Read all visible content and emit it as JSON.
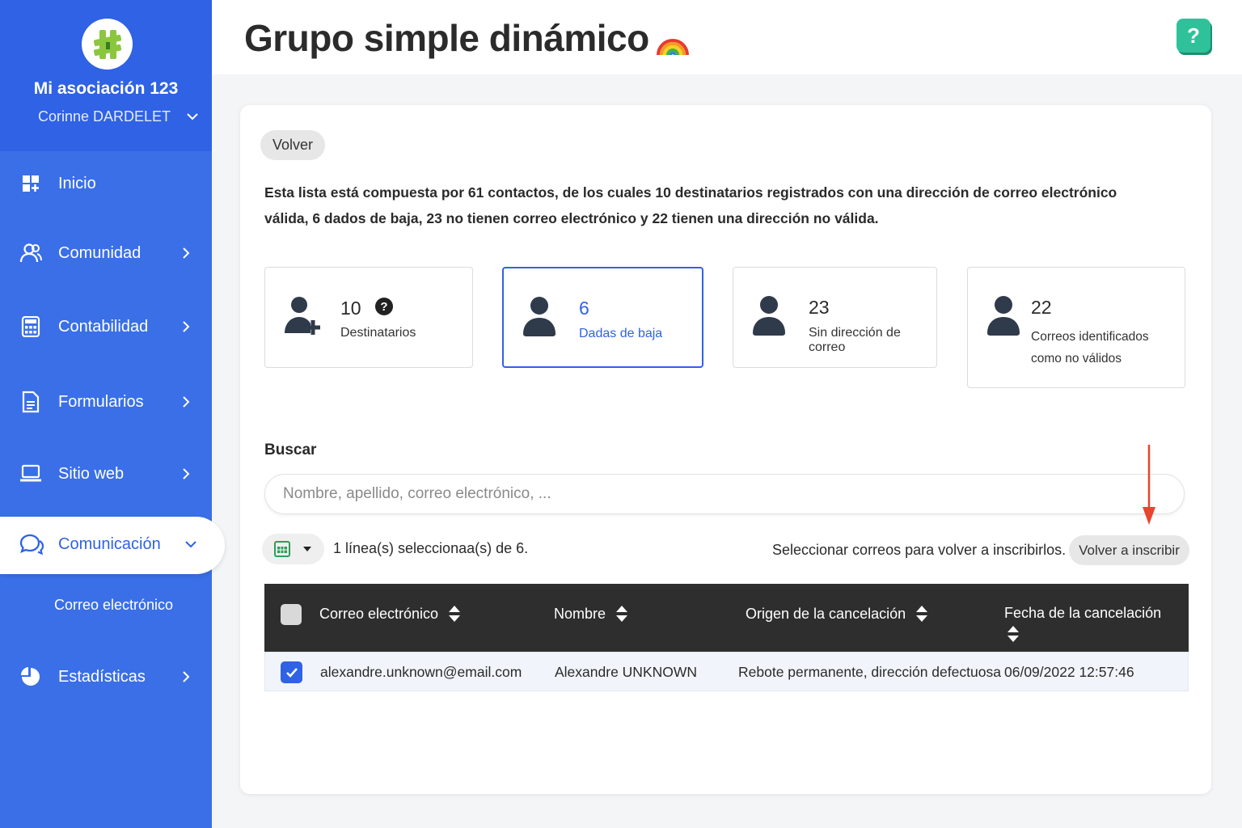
{
  "sidebar": {
    "org_name": "Mi asociación 123",
    "user_name": "Corinne DARDELET",
    "items": [
      {
        "label": "Inicio"
      },
      {
        "label": "Comunidad"
      },
      {
        "label": "Contabilidad"
      },
      {
        "label": "Formularios"
      },
      {
        "label": "Sitio web"
      },
      {
        "label": "Comunicación"
      },
      {
        "label": "Estadísticas"
      }
    ],
    "sub_item": "Correo electrónico",
    "brand_color": "#3a6fe8"
  },
  "header": {
    "title": "Grupo simple dinámico",
    "help_label": "?"
  },
  "main": {
    "back_label": "Volver",
    "summary": "Esta lista está compuesta por 61 contactos, de los cuales 10 destinatarios registrados con una dirección de correo electrónico válida, 6 dados de baja, 23 no tienen correo electrónico y 22 tienen una dirección no válida.",
    "stats": [
      {
        "value": "10",
        "label": "Destinatarios",
        "icon": "user-add-icon"
      },
      {
        "value": "6",
        "label": "Dadas de baja",
        "icon": "user-icon"
      },
      {
        "value": "23",
        "label": "Sin dirección de correo",
        "icon": "user-icon"
      },
      {
        "value": "22",
        "label": "Correos identificados como no válidos",
        "icon": "user-icon"
      }
    ],
    "search": {
      "label": "Buscar",
      "placeholder": "Nombre, apellido, correo electrónico, ..."
    },
    "selection_count": "1 línea(s) seleccionaa(s) de 6.",
    "selection_hint": "Seleccionar correos para volver a inscribirlos.",
    "resubscribe_label": "Volver a inscribir",
    "table": {
      "columns": [
        "Correo electrónico",
        "Nombre",
        "Origen de la cancelación",
        "Fecha de la cancelación"
      ],
      "rows": [
        {
          "email": "alexandre.unknown@email.com",
          "name": "Alexandre UNKNOWN",
          "origin": "Rebote permanente, dirección defectuosa",
          "date": "06/09/2022 12:57:46",
          "checked": true
        }
      ]
    }
  }
}
